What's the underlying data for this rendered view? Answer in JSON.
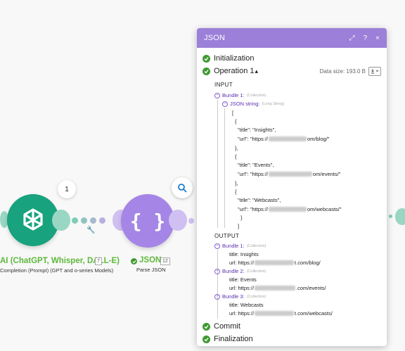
{
  "canvas": {
    "openai_module": {
      "title": "AI (ChatGPT, Whisper, DALL-E)",
      "subtitle": "Completion (Prompt) (GPT and o-series Models)",
      "number": "7",
      "bubble_count": "1"
    },
    "json_module": {
      "title": "JSON",
      "subtitle": "Parse JSON",
      "number": "12",
      "icon_text": "{ }"
    }
  },
  "panel": {
    "title": "JSON",
    "header_buttons": {
      "expand": "⤢",
      "help": "?",
      "close": "×"
    },
    "sections": {
      "initialization": "Initialization",
      "operation": "Operation 1",
      "operation_caret": "▴",
      "commit": "Commit",
      "finalization": "Finalization"
    },
    "data_size": "Data size: 193.0 B",
    "input": {
      "label": "INPUT",
      "bundle": "Bundle 1:",
      "bundle_hint": "(Collection)",
      "json_key": "JSON string:",
      "json_hint": "(Long String)",
      "lines": [
        "[",
        "{",
        "\"title\": \"Insights\",",
        "\"url\": \"https://",
        "om/blog/\"",
        "},",
        "{",
        "\"title\": \"Events\",",
        "\"url\": \"https://",
        "om/events/\"",
        "},",
        "{",
        "\"title\": \"Webcasts\",",
        "\"url\": \"https://",
        "om/webcasts/\"",
        "}",
        "]"
      ]
    },
    "output": {
      "label": "OUTPUT",
      "bundles": [
        {
          "label": "Bundle 1:",
          "hint": "(Collection)",
          "title_key": "title:",
          "title_val": "Insights",
          "url_key": "url:",
          "url_pre": "https://",
          "url_post": "t.com/blog/"
        },
        {
          "label": "Bundle 2:",
          "hint": "(Collection)",
          "title_key": "title:",
          "title_val": "Events",
          "url_key": "url:",
          "url_pre": "https://",
          "url_post": ".com/events/"
        },
        {
          "label": "Bundle 3:",
          "hint": "(Collection)",
          "title_key": "title:",
          "title_val": "Webcasts",
          "url_key": "url:",
          "url_pre": "https://",
          "url_post": "t.com/webcasts/"
        }
      ]
    }
  },
  "colors": {
    "openai_green": "#18a27d",
    "json_purple": "#a585e6",
    "panel_header": "#9b7fd8",
    "status_green": "#3e9a2f",
    "title_green": "#5db83a"
  }
}
